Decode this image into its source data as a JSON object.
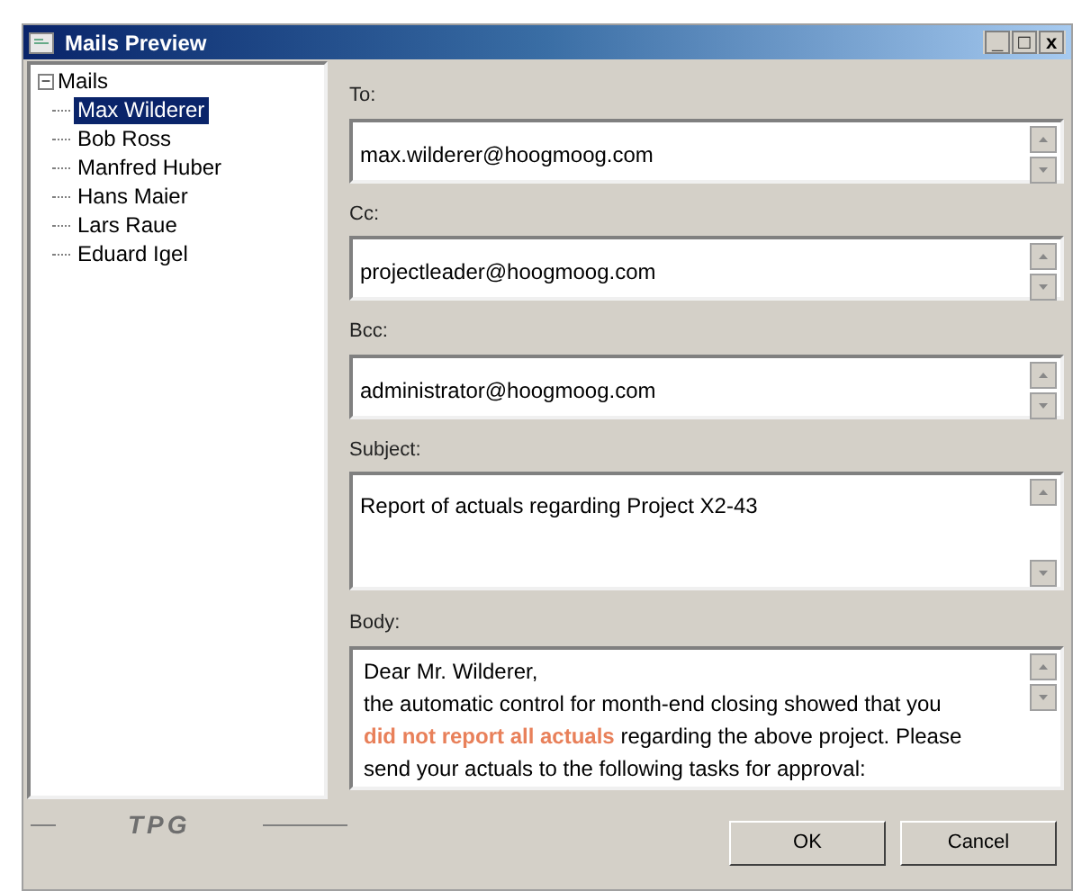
{
  "window": {
    "title": "Mails Preview",
    "controls": [
      "_",
      "□",
      "x"
    ]
  },
  "tree": {
    "label": "Mails",
    "expander": "−",
    "expanded": true,
    "children": [
      {
        "label": "Max Wilderer",
        "selected": true
      },
      {
        "label": "Bob Ross",
        "selected": false
      },
      {
        "label": "Manfred Huber",
        "selected": false
      },
      {
        "label": "Hans Maier",
        "selected": false
      },
      {
        "label": "Lars Raue",
        "selected": false
      },
      {
        "label": "Eduard Igel",
        "selected": false
      }
    ]
  },
  "fields": [
    {
      "label": "To:",
      "value": "max.wilderer@hoogmoog.com",
      "kind": "line"
    },
    {
      "label": "Cc:",
      "value": "projectleader@hoogmoog.com",
      "kind": "line"
    },
    {
      "label": "Bcc:",
      "value": "administrator@hoogmoog.com",
      "kind": "line"
    },
    {
      "label": "Subject:",
      "value": "Report of actuals regarding Project X2-43",
      "kind": "multi"
    }
  ],
  "body": {
    "label": "Body:",
    "lines": [
      [
        {
          "text": "Dear Mr. Wilderer,",
          "kind": "normal"
        }
      ],
      [
        {
          "text": "the automatic control for month-end closing showed that you",
          "kind": "normal"
        }
      ],
      [
        {
          "text": "did not report all actuals",
          "kind": "highlight"
        },
        {
          "text": " regarding the above project. Please",
          "kind": "normal"
        }
      ],
      [
        {
          "text": "send your actuals to the following tasks for approval:",
          "kind": "normal"
        }
      ]
    ]
  },
  "logo": "TPG",
  "buttons": [
    {
      "label": "OK"
    },
    {
      "label": "Cancel"
    }
  ]
}
